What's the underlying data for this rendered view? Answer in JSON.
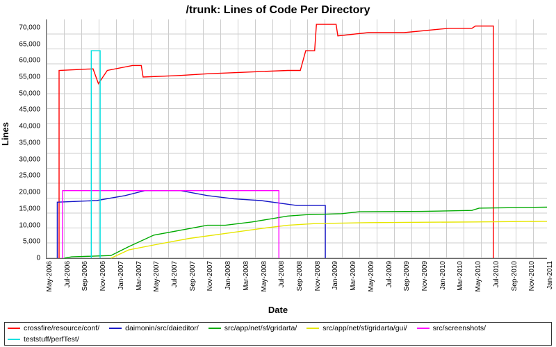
{
  "chart_data": {
    "type": "line",
    "title": "/trunk: Lines of Code Per Directory",
    "xlabel": "Date",
    "ylabel": "Lines",
    "ylim": [
      0,
      72500
    ],
    "yticks": [
      0,
      5000,
      10000,
      15000,
      20000,
      25000,
      30000,
      35000,
      40000,
      45000,
      50000,
      55000,
      60000,
      65000,
      70000
    ],
    "ytick_labels": [
      "0",
      "5,000",
      "10,000",
      "15,000",
      "20,000",
      "25,000",
      "30,000",
      "35,000",
      "40,000",
      "45,000",
      "50,000",
      "55,000",
      "60,000",
      "65,000",
      "70,000"
    ],
    "x_categories": [
      "May-2006",
      "Jul-2006",
      "Sep-2006",
      "Nov-2006",
      "Jan-2007",
      "Mar-2007",
      "May-2007",
      "Jul-2007",
      "Sep-2007",
      "Nov-2007",
      "Jan-2008",
      "Mar-2008",
      "May-2008",
      "Jul-2008",
      "Sep-2008",
      "Nov-2008",
      "Jan-2009",
      "Mar-2009",
      "May-2009",
      "Jul-2009",
      "Sep-2009",
      "Nov-2009",
      "Jan-2010",
      "Mar-2010",
      "May-2010",
      "Jul-2010",
      "Sep-2010",
      "Nov-2010",
      "Jan-2011"
    ],
    "series": [
      {
        "name": "crossfire/resource/conf/",
        "color": "#ff0000",
        "points": [
          {
            "x": 0.7,
            "y": 0
          },
          {
            "x": 0.7,
            "y": 57000
          },
          {
            "x": 2.6,
            "y": 57500
          },
          {
            "x": 2.9,
            "y": 53000
          },
          {
            "x": 3.4,
            "y": 57000
          },
          {
            "x": 4.8,
            "y": 58500
          },
          {
            "x": 5.3,
            "y": 58500
          },
          {
            "x": 5.4,
            "y": 55000
          },
          {
            "x": 7.5,
            "y": 55500
          },
          {
            "x": 9.0,
            "y": 56000
          },
          {
            "x": 13.5,
            "y": 57000
          },
          {
            "x": 14.2,
            "y": 57000
          },
          {
            "x": 14.5,
            "y": 63000
          },
          {
            "x": 15.0,
            "y": 63000
          },
          {
            "x": 15.1,
            "y": 71000
          },
          {
            "x": 16.2,
            "y": 71000
          },
          {
            "x": 16.3,
            "y": 67500
          },
          {
            "x": 18.0,
            "y": 68500
          },
          {
            "x": 20.0,
            "y": 68500
          },
          {
            "x": 22.5,
            "y": 69800
          },
          {
            "x": 23.8,
            "y": 69800
          },
          {
            "x": 24.0,
            "y": 70500
          },
          {
            "x": 25.0,
            "y": 70500
          },
          {
            "x": 25.0,
            "y": 0
          }
        ]
      },
      {
        "name": "daimonin/src/daieditor/",
        "color": "#1818c8",
        "points": [
          {
            "x": 0.6,
            "y": 0
          },
          {
            "x": 0.6,
            "y": 17000
          },
          {
            "x": 2.8,
            "y": 17500
          },
          {
            "x": 4.4,
            "y": 19000
          },
          {
            "x": 5.5,
            "y": 20500
          },
          {
            "x": 7.5,
            "y": 20500
          },
          {
            "x": 9.0,
            "y": 19000
          },
          {
            "x": 10.5,
            "y": 18000
          },
          {
            "x": 12.0,
            "y": 17500
          },
          {
            "x": 14.0,
            "y": 16000
          },
          {
            "x": 15.6,
            "y": 16000
          },
          {
            "x": 15.6,
            "y": 0
          }
        ]
      },
      {
        "name": "src/app/net/sf/gridarta/",
        "color": "#00aa00",
        "points": [
          {
            "x": 1.0,
            "y": 0
          },
          {
            "x": 1.4,
            "y": 400
          },
          {
            "x": 3.6,
            "y": 800
          },
          {
            "x": 4.6,
            "y": 3500
          },
          {
            "x": 6.0,
            "y": 7000
          },
          {
            "x": 7.5,
            "y": 8500
          },
          {
            "x": 9.0,
            "y": 10000
          },
          {
            "x": 10.0,
            "y": 10000
          },
          {
            "x": 11.5,
            "y": 11000
          },
          {
            "x": 13.5,
            "y": 12800
          },
          {
            "x": 14.5,
            "y": 13200
          },
          {
            "x": 16.5,
            "y": 13500
          },
          {
            "x": 17.5,
            "y": 14100
          },
          {
            "x": 21.0,
            "y": 14200
          },
          {
            "x": 23.8,
            "y": 14500
          },
          {
            "x": 24.2,
            "y": 15200
          },
          {
            "x": 28.0,
            "y": 15500
          }
        ]
      },
      {
        "name": "src/app/net/sf/gridarta/gui/",
        "color": "#e6e600",
        "points": [
          {
            "x": 3.6,
            "y": 0
          },
          {
            "x": 4.6,
            "y": 2500
          },
          {
            "x": 6.0,
            "y": 4000
          },
          {
            "x": 8.0,
            "y": 6000
          },
          {
            "x": 10.0,
            "y": 7500
          },
          {
            "x": 12.0,
            "y": 9000
          },
          {
            "x": 13.5,
            "y": 10000
          },
          {
            "x": 15.0,
            "y": 10500
          },
          {
            "x": 18.0,
            "y": 10800
          },
          {
            "x": 24.0,
            "y": 11000
          },
          {
            "x": 28.0,
            "y": 11200
          }
        ]
      },
      {
        "name": "src/screenshots/",
        "color": "#ff00ff",
        "points": [
          {
            "x": 0.9,
            "y": 0
          },
          {
            "x": 0.9,
            "y": 20500
          },
          {
            "x": 13.0,
            "y": 20500
          },
          {
            "x": 13.0,
            "y": 0
          }
        ]
      },
      {
        "name": "teststuff/perfTest/",
        "color": "#00e0e0",
        "points": [
          {
            "x": 2.5,
            "y": 0
          },
          {
            "x": 2.5,
            "y": 63000
          },
          {
            "x": 3.0,
            "y": 63000
          },
          {
            "x": 3.0,
            "y": 0
          }
        ]
      }
    ]
  }
}
